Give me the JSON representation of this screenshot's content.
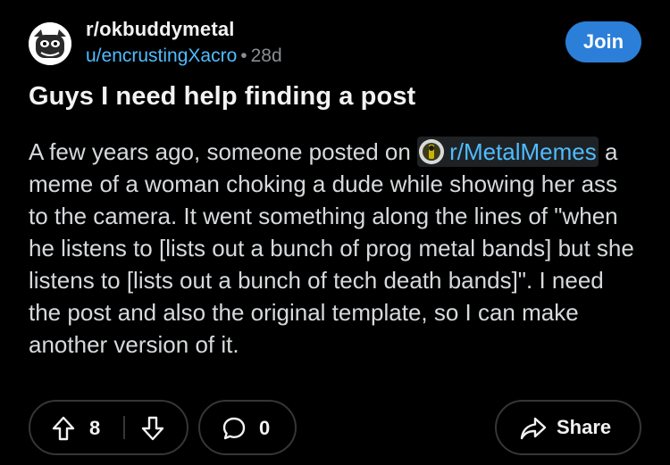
{
  "header": {
    "subreddit": "r/okbuddymetal",
    "author": "u/encrustingXacro",
    "separator": "•",
    "age": "28d",
    "join_label": "Join"
  },
  "post": {
    "title": "Guys I need help finding a post",
    "body_before_link": "A few years ago, someone posted on ",
    "linked_subreddit": "r/MetalMemes",
    "body_after_link": " a meme of a woman choking a dude while showing her ass to the camera. It went something along the lines of \"when he listens to [lists out a bunch of prog metal bands] but she listens to [lists out a bunch of tech death bands]\". I need the post and also the original template, so I can make another version of it."
  },
  "actions": {
    "upvote_icon": "arrow-up-icon",
    "vote_count": "8",
    "downvote_icon": "arrow-down-icon",
    "comment_icon": "speech-bubble-icon",
    "comment_count": "0",
    "share_icon": "share-arrow-icon",
    "share_label": "Share"
  },
  "colors": {
    "background": "#000000",
    "link": "#4fbcff",
    "join_button": "#2b7fd8",
    "muted_text": "#8a8d91",
    "border": "#343638"
  }
}
